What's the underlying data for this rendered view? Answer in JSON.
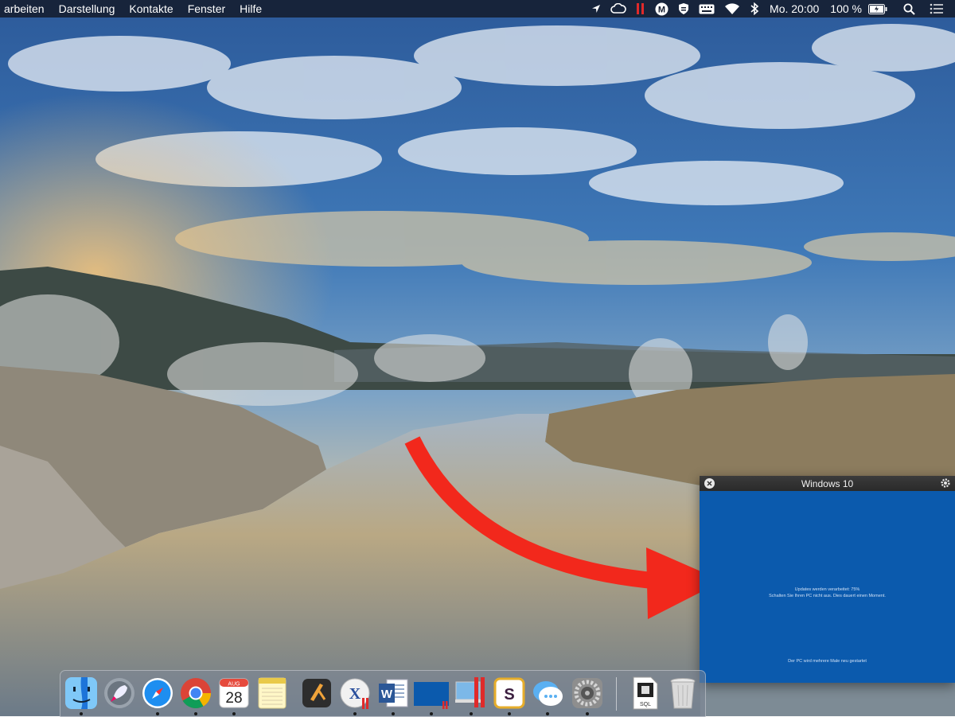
{
  "menubar": {
    "menus": [
      "arbeiten",
      "Darstellung",
      "Kontakte",
      "Fenster",
      "Hilfe"
    ],
    "status_icons": [
      "location-icon",
      "cloud-icon",
      "parallels-icon",
      "m-icon",
      "shield-icon",
      "keyboard-icon",
      "wifi-icon",
      "bluetooth-icon"
    ],
    "clock": "Mo. 20:00",
    "battery": "100 %",
    "right_icons": [
      "spotlight-icon",
      "notification-center-icon"
    ]
  },
  "vm_window": {
    "title": "Windows 10",
    "update_line1": "Updates werden verarbeitet: 75%",
    "update_line2": "Schalten Sie Ihren PC nicht aus. Dies dauert einen Moment.",
    "restart_note": "Der PC wird mehrere Male neu gestartet",
    "screen_color": "#0b5aad"
  },
  "dock": {
    "apps": [
      {
        "name": "Finder",
        "icon": "finder-icon"
      },
      {
        "name": "Launchpad",
        "icon": "launchpad-icon"
      },
      {
        "name": "Safari",
        "icon": "safari-icon"
      },
      {
        "name": "Chrome",
        "icon": "chrome-icon"
      },
      {
        "name": "Kalender",
        "icon": "calendar-icon",
        "month": "AUG",
        "day": "28"
      },
      {
        "name": "Notizen",
        "icon": "notes-icon"
      },
      {
        "name": "Xcode",
        "icon": "xcode-icon"
      },
      {
        "name": "Crossover",
        "icon": "crossover-icon"
      },
      {
        "name": "Word",
        "icon": "word-icon"
      },
      {
        "name": "Windows 10",
        "icon": "windows-vm-icon"
      },
      {
        "name": "Parallels",
        "icon": "parallels-desktop-icon"
      },
      {
        "name": "Slack",
        "icon": "slack-icon"
      },
      {
        "name": "Nachrichten",
        "icon": "messages-icon"
      },
      {
        "name": "Systemeinstellungen",
        "icon": "system-preferences-icon"
      },
      {
        "name": "SQL",
        "icon": "sql-document-icon",
        "label": "SQL"
      },
      {
        "name": "Papierkorb",
        "icon": "trash-icon"
      }
    ]
  },
  "colors": {
    "arrow": "#f2281c",
    "menubar": "#141c2d"
  }
}
